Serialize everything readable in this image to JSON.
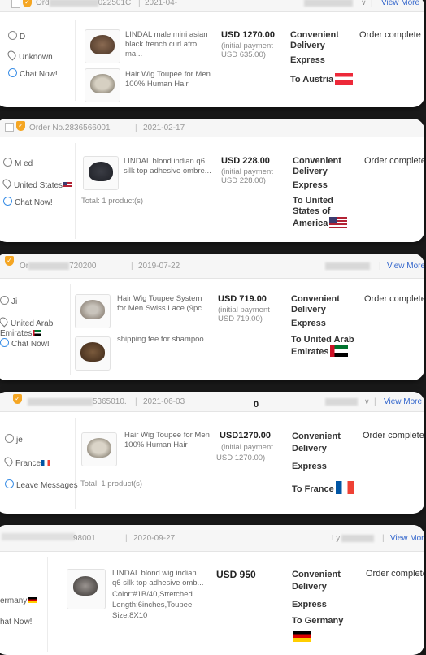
{
  "orders": [
    {
      "header": {
        "order_prefix": "Ord",
        "order_suffix": "022501C",
        "date": "2021-04-",
        "view_more": "View More"
      },
      "buyer": {
        "name": "D",
        "location": "Unknown",
        "contact": "Chat Now!"
      },
      "products": [
        {
          "name": "LINDAL male mini asian black french curl afro ma..."
        },
        {
          "name": "Hair Wig Toupee for Men 100% Human Hair"
        }
      ],
      "total": "",
      "price": {
        "amount": "USD 1270.00",
        "label": "(initial payment",
        "paid": "USD 635.00)"
      },
      "delivery": {
        "line1": "Convenient",
        "line2": "Delivery",
        "method": "Express",
        "to": "To Austria"
      },
      "status": "Order complete"
    },
    {
      "header": {
        "order_prefix": "Order No.",
        "order_suffix": "2836566001",
        "date": "2021-02-17",
        "view_more": ""
      },
      "buyer": {
        "name": "M          ed",
        "location": "United States",
        "contact": "Chat Now!"
      },
      "products": [
        {
          "name": "LINDAL blond indian q6 silk top adhesive ombre..."
        }
      ],
      "total": "Total:  1 product(s)",
      "price": {
        "amount": "USD 228.00",
        "label": "(initial payment",
        "paid": "USD 228.00)"
      },
      "delivery": {
        "line1": "Convenient",
        "line2": "Delivery",
        "method": "Express",
        "to": "To United States of America"
      },
      "status": "Order complete"
    },
    {
      "header": {
        "order_prefix": "Or",
        "order_suffix": "720200",
        "date": "2019-07-22",
        "view_more": "View More"
      },
      "buyer": {
        "name": "Ji",
        "location": "United Arab Emirates",
        "contact": "Chat Now!"
      },
      "products": [
        {
          "name": "Hair Wig Toupee System for Men Swiss Lace  (9pc..."
        },
        {
          "name": "shipping fee for shampoo"
        }
      ],
      "total": "",
      "price": {
        "amount": "USD 719.00",
        "label": "(initial payment",
        "paid": "USD 719.00)"
      },
      "delivery": {
        "line1": "Convenient",
        "line2": "Delivery",
        "method": "Express",
        "to": "To United Arab Emirates"
      },
      "status": "Order complete"
    },
    {
      "header": {
        "order_prefix": "",
        "order_suffix": "5365010.",
        "date": "2021-06-03",
        "view_more": "View More",
        "extra": "0"
      },
      "buyer": {
        "name": "je",
        "location": "France",
        "contact": "Leave Messages"
      },
      "products": [
        {
          "name": "Hair Wig Toupee for Men 100% Human Hair"
        }
      ],
      "total": "Total:  1 product(s)",
      "price": {
        "amount": "USD1270.00",
        "label": "(initial payment",
        "paid": "USD 1270.00)"
      },
      "delivery": {
        "line1": "Convenient",
        "line2": "Delivery",
        "method": "Express",
        "to": "To France"
      },
      "status": "Order complete"
    },
    {
      "header": {
        "order_prefix": "",
        "order_suffix": "98001",
        "date": "2020-09-27",
        "view_more": "View More",
        "extra": "Ly"
      },
      "buyer": {
        "name": "",
        "location": "ermany",
        "contact": "hat Now!"
      },
      "products": [
        {
          "name": "LINDAL blond wig indian q6 silk top adhesive omb...",
          "sku1": "Color:#1B/40,Stretched",
          "sku2": "Length:6inches,Toupee",
          "sku3": "Size:8X10"
        }
      ],
      "total": "",
      "price": {
        "amount": "USD 950",
        "label": "",
        "paid": ""
      },
      "delivery": {
        "line1": "Convenient",
        "line2": "Delivery",
        "method": "Express",
        "to": "To Germany"
      },
      "status": "Order complete"
    }
  ]
}
